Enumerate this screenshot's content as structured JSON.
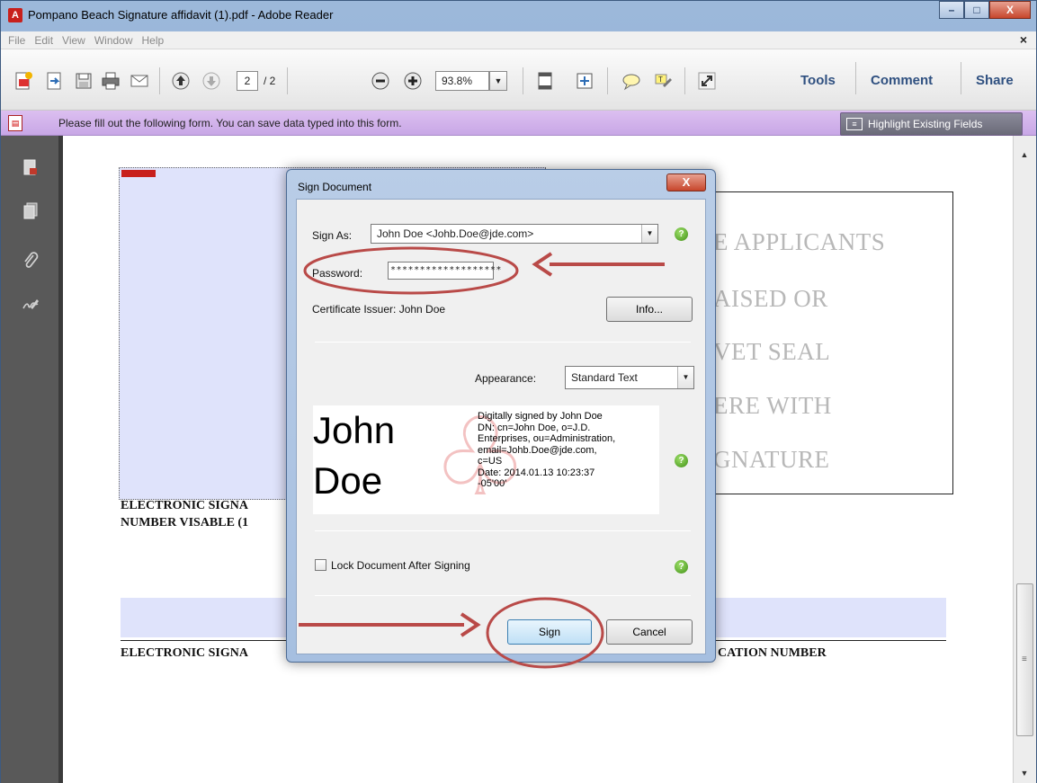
{
  "window": {
    "title": "Pompano Beach Signature affidavit (1).pdf - Adobe Reader",
    "app_icon": "adobe-reader-icon",
    "buttons": {
      "minimize": "–",
      "maximize": "□",
      "close": "X"
    }
  },
  "menu": {
    "items": [
      "File",
      "Edit",
      "View",
      "Window",
      "Help"
    ],
    "close_glyph": "×"
  },
  "toolbar": {
    "page_current": "2",
    "page_total": "/ 2",
    "zoom": "93.8%",
    "links": {
      "tools": "Tools",
      "comment": "Comment",
      "share": "Share"
    }
  },
  "formbar": {
    "message": "Please fill out the following form. You can save data typed into this form.",
    "highlight_button": "Highlight Existing Fields"
  },
  "document": {
    "stamp_lines": [
      "E APPLICANTS",
      "AISED OR",
      "VET SEAL",
      "ERE WITH",
      "GNATURE"
    ],
    "label_left_1": "ELECTRONIC SIGNA",
    "label_left_2": "NUMBER VISABLE (1",
    "label_bottom_left": "ELECTRONIC SIGNA",
    "label_bottom_right": "CATION NUMBER"
  },
  "dialog": {
    "title": "Sign Document",
    "close_label": "X",
    "sign_as_label": "Sign As:",
    "sign_as_value": "John Doe <Johb.Doe@jde.com>",
    "password_label": "Password:",
    "password_value": "*******************",
    "certificate_issuer": "Certificate Issuer: John Doe",
    "info_button": "Info...",
    "appearance_label": "Appearance:",
    "appearance_value": "Standard Text",
    "preview_name_line1": "John",
    "preview_name_line2": "Doe",
    "preview_details": "Digitally signed by John Doe\nDN: cn=John Doe, o=J.D.\nEnterprises, ou=Administration,\nemail=Johb.Doe@jde.com,\nc=US\nDate: 2014.01.13 10:23:37\n-05'00'",
    "lock_label": "Lock Document After Signing",
    "sign_button": "Sign",
    "cancel_button": "Cancel",
    "help_glyph": "?"
  },
  "annotation_color": "#b94a48"
}
